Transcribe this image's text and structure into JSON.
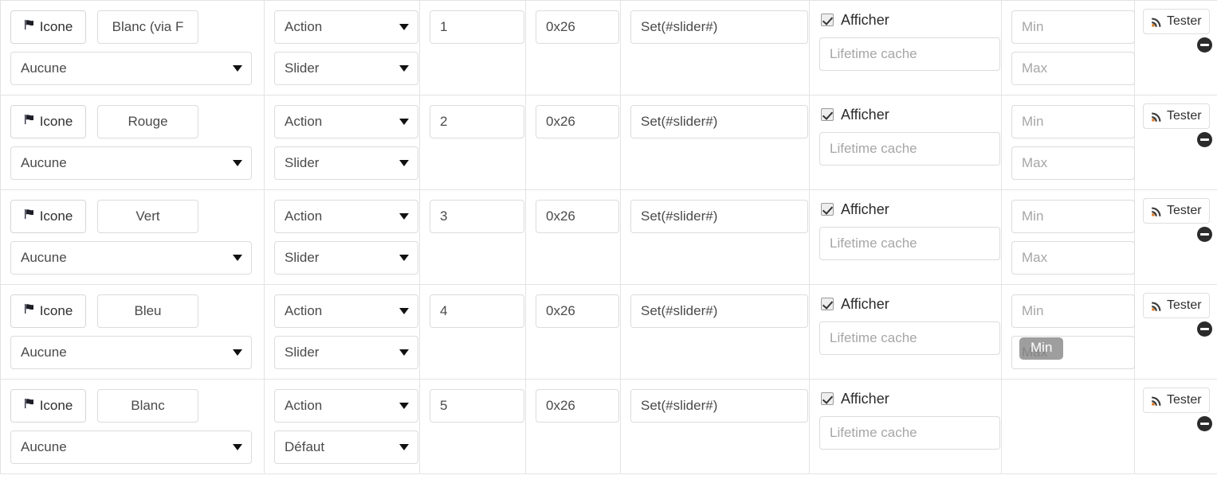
{
  "labels": {
    "icone_button": "Icone",
    "afficher": "Afficher",
    "tester": "Tester",
    "icon_flag": "flag-icon",
    "icon_rss": "rss-icon",
    "icon_minus": "minus-circle-icon",
    "icon_caret": "chevron-down-icon"
  },
  "placeholders": {
    "lifetime_cache": "Lifetime cache",
    "min": "Min",
    "max": "Max"
  },
  "tooltip": {
    "text": "Min"
  },
  "colors": {
    "border": "#e3e3e3",
    "control_border": "#dcdcdc",
    "placeholder_text": "#a6a6a6",
    "text": "#4a4a4a",
    "minus_icon": "#2b2b2b"
  },
  "rows": [
    {
      "icone_label": "Icone",
      "color_value": "Blanc (via F",
      "selector_value": "Aucune",
      "action_value": "Action",
      "type_value": "Slider",
      "order_value": "1",
      "address_value": "0x26",
      "request_value": "Set(#slider#)",
      "afficher_checked": true,
      "cache_value": "",
      "min_value": "",
      "max_value": "",
      "has_minmax": true,
      "tester_label": "Tester"
    },
    {
      "icone_label": "Icone",
      "color_value": "Rouge",
      "selector_value": "Aucune",
      "action_value": "Action",
      "type_value": "Slider",
      "order_value": "2",
      "address_value": "0x26",
      "request_value": "Set(#slider#)",
      "afficher_checked": true,
      "cache_value": "",
      "min_value": "",
      "max_value": "",
      "has_minmax": true,
      "tester_label": "Tester"
    },
    {
      "icone_label": "Icone",
      "color_value": "Vert",
      "selector_value": "Aucune",
      "action_value": "Action",
      "type_value": "Slider",
      "order_value": "3",
      "address_value": "0x26",
      "request_value": "Set(#slider#)",
      "afficher_checked": true,
      "cache_value": "",
      "min_value": "",
      "max_value": "",
      "has_minmax": true,
      "tester_label": "Tester"
    },
    {
      "icone_label": "Icone",
      "color_value": "Bleu",
      "selector_value": "Aucune",
      "action_value": "Action",
      "type_value": "Slider",
      "order_value": "4",
      "address_value": "0x26",
      "request_value": "Set(#slider#)",
      "afficher_checked": true,
      "cache_value": "",
      "min_value": "",
      "max_value": "",
      "has_minmax": true,
      "tester_label": "Tester",
      "tooltip_on_max": true
    },
    {
      "icone_label": "Icone",
      "color_value": "Blanc",
      "selector_value": "Aucune",
      "action_value": "Action",
      "type_value": "Défaut",
      "order_value": "5",
      "address_value": "0x26",
      "request_value": "Set(#slider#)",
      "afficher_checked": true,
      "cache_value": "",
      "min_value": "",
      "max_value": "",
      "has_minmax": false,
      "tester_label": "Tester"
    }
  ]
}
